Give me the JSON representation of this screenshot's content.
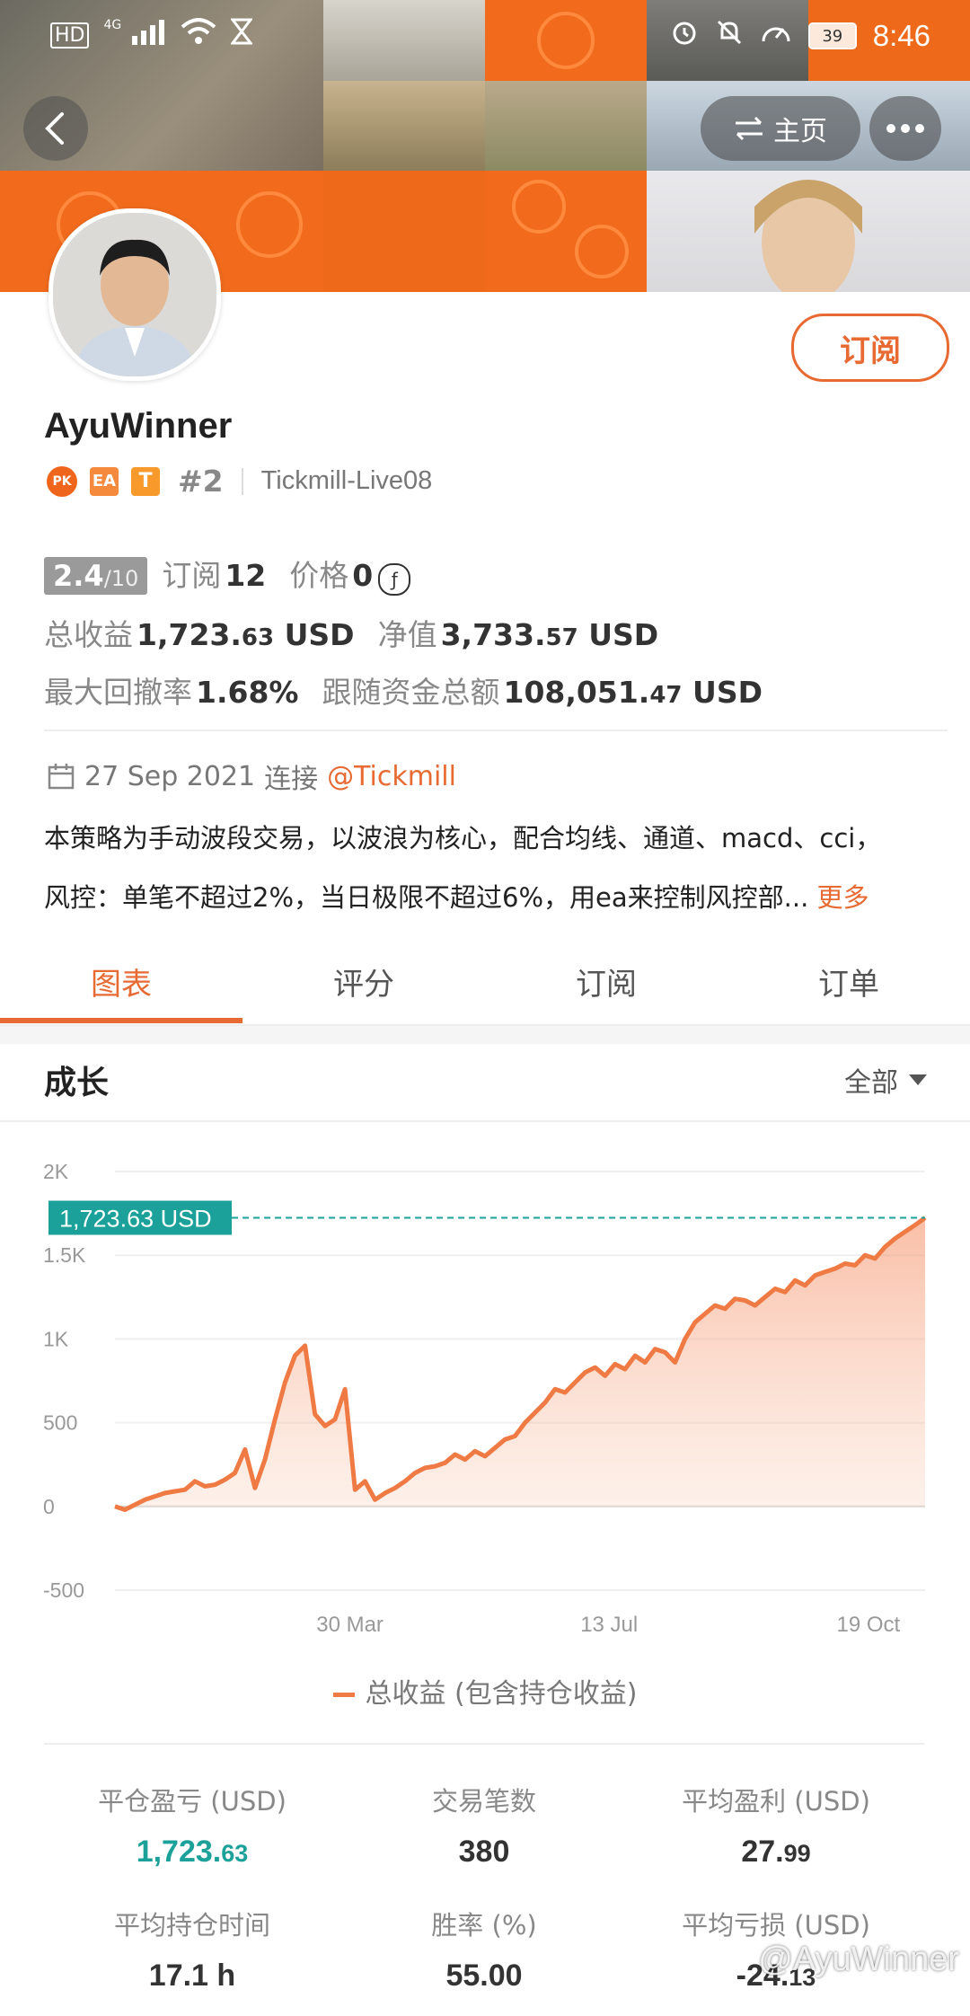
{
  "status_bar": {
    "left": [
      "HD",
      "4G"
    ],
    "battery": "39",
    "time": "8:46"
  },
  "header": {
    "home_label": "主页"
  },
  "profile": {
    "name": "AyuWinner",
    "subscribe_label": "订阅",
    "badges": {
      "pk": "PK",
      "ea": "EA",
      "t": "T",
      "rank": "#2"
    },
    "server": "Tickmill-Live08",
    "score": "2.4",
    "score_max": "/10",
    "subs_label": "订阅",
    "subs_value": "12",
    "price_label": "价格",
    "price_value": "0",
    "price_icon": "ƒ",
    "total_profit_label": "总收益",
    "total_profit_main": "1,723.",
    "total_profit_dec": "63",
    "total_profit_unit": "USD",
    "equity_label": "净值",
    "equity_main": "3,733.",
    "equity_dec": "57",
    "equity_unit": "USD",
    "drawdown_label": "最大回撤率",
    "drawdown_value": "1.68%",
    "follow_label": "跟随资金总额",
    "follow_main": "108,051.",
    "follow_dec": "47",
    "follow_unit": "USD",
    "date": "27 Sep 2021",
    "connect": "连接",
    "broker_link": "@Tickmill",
    "desc1": "本策略为手动波段交易，以波浪为核心，配合均线、通道、macd、cci，",
    "desc2": "风控：单笔不超过2%，当日极限不超过6%，用ea来控制风控部...",
    "more": "更多"
  },
  "tabs": [
    "图表",
    "评分",
    "订阅",
    "订单"
  ],
  "growth": {
    "title": "成长",
    "filter": "全部"
  },
  "chart_data": {
    "type": "line",
    "title": "成长",
    "y_ticks": [
      "2K",
      "1.5K",
      "1K",
      "500",
      "0",
      "-500"
    ],
    "ylim": [
      -500,
      2000
    ],
    "x_ticks": [
      "30 Mar",
      "13 Jul",
      "19 Oct"
    ],
    "current_label": "1,723.63 USD",
    "current_value": 1723.63,
    "legend": "总收益 (包含持仓收益)",
    "series": [
      {
        "name": "总收益 (包含持仓收益)",
        "values": [
          0,
          -20,
          10,
          40,
          60,
          80,
          90,
          100,
          150,
          120,
          130,
          160,
          200,
          340,
          110,
          280,
          520,
          740,
          900,
          960,
          550,
          480,
          520,
          700,
          100,
          150,
          40,
          80,
          110,
          150,
          200,
          230,
          240,
          260,
          310,
          280,
          330,
          300,
          350,
          400,
          420,
          500,
          560,
          620,
          700,
          680,
          740,
          800,
          830,
          780,
          850,
          820,
          900,
          860,
          940,
          920,
          860,
          1000,
          1100,
          1150,
          1200,
          1180,
          1240,
          1230,
          1200,
          1250,
          1300,
          1280,
          1350,
          1320,
          1380,
          1400,
          1420,
          1450,
          1440,
          1500,
          1480,
          1550,
          1600,
          1640,
          1680,
          1723.63
        ]
      }
    ]
  },
  "stats": [
    {
      "label": "平仓盈亏 (USD)",
      "main": "1,723.",
      "dec": "63"
    },
    {
      "label": "交易笔数",
      "main": "380",
      "dec": ""
    },
    {
      "label": "平均盈利 (USD)",
      "main": "27.",
      "dec": "99"
    },
    {
      "label": "平均持仓时间",
      "main": "17.1 h",
      "dec": ""
    },
    {
      "label": "胜率 (%)",
      "main": "55.00",
      "dec": ""
    },
    {
      "label": "平均亏损 (USD)",
      "main": "-24.",
      "dec": "13"
    }
  ],
  "watermark": "@AyuWinner",
  "colors": {
    "accent": "#e86a33",
    "teal": "#1ba19a",
    "header_orange": "#f26b1d"
  }
}
